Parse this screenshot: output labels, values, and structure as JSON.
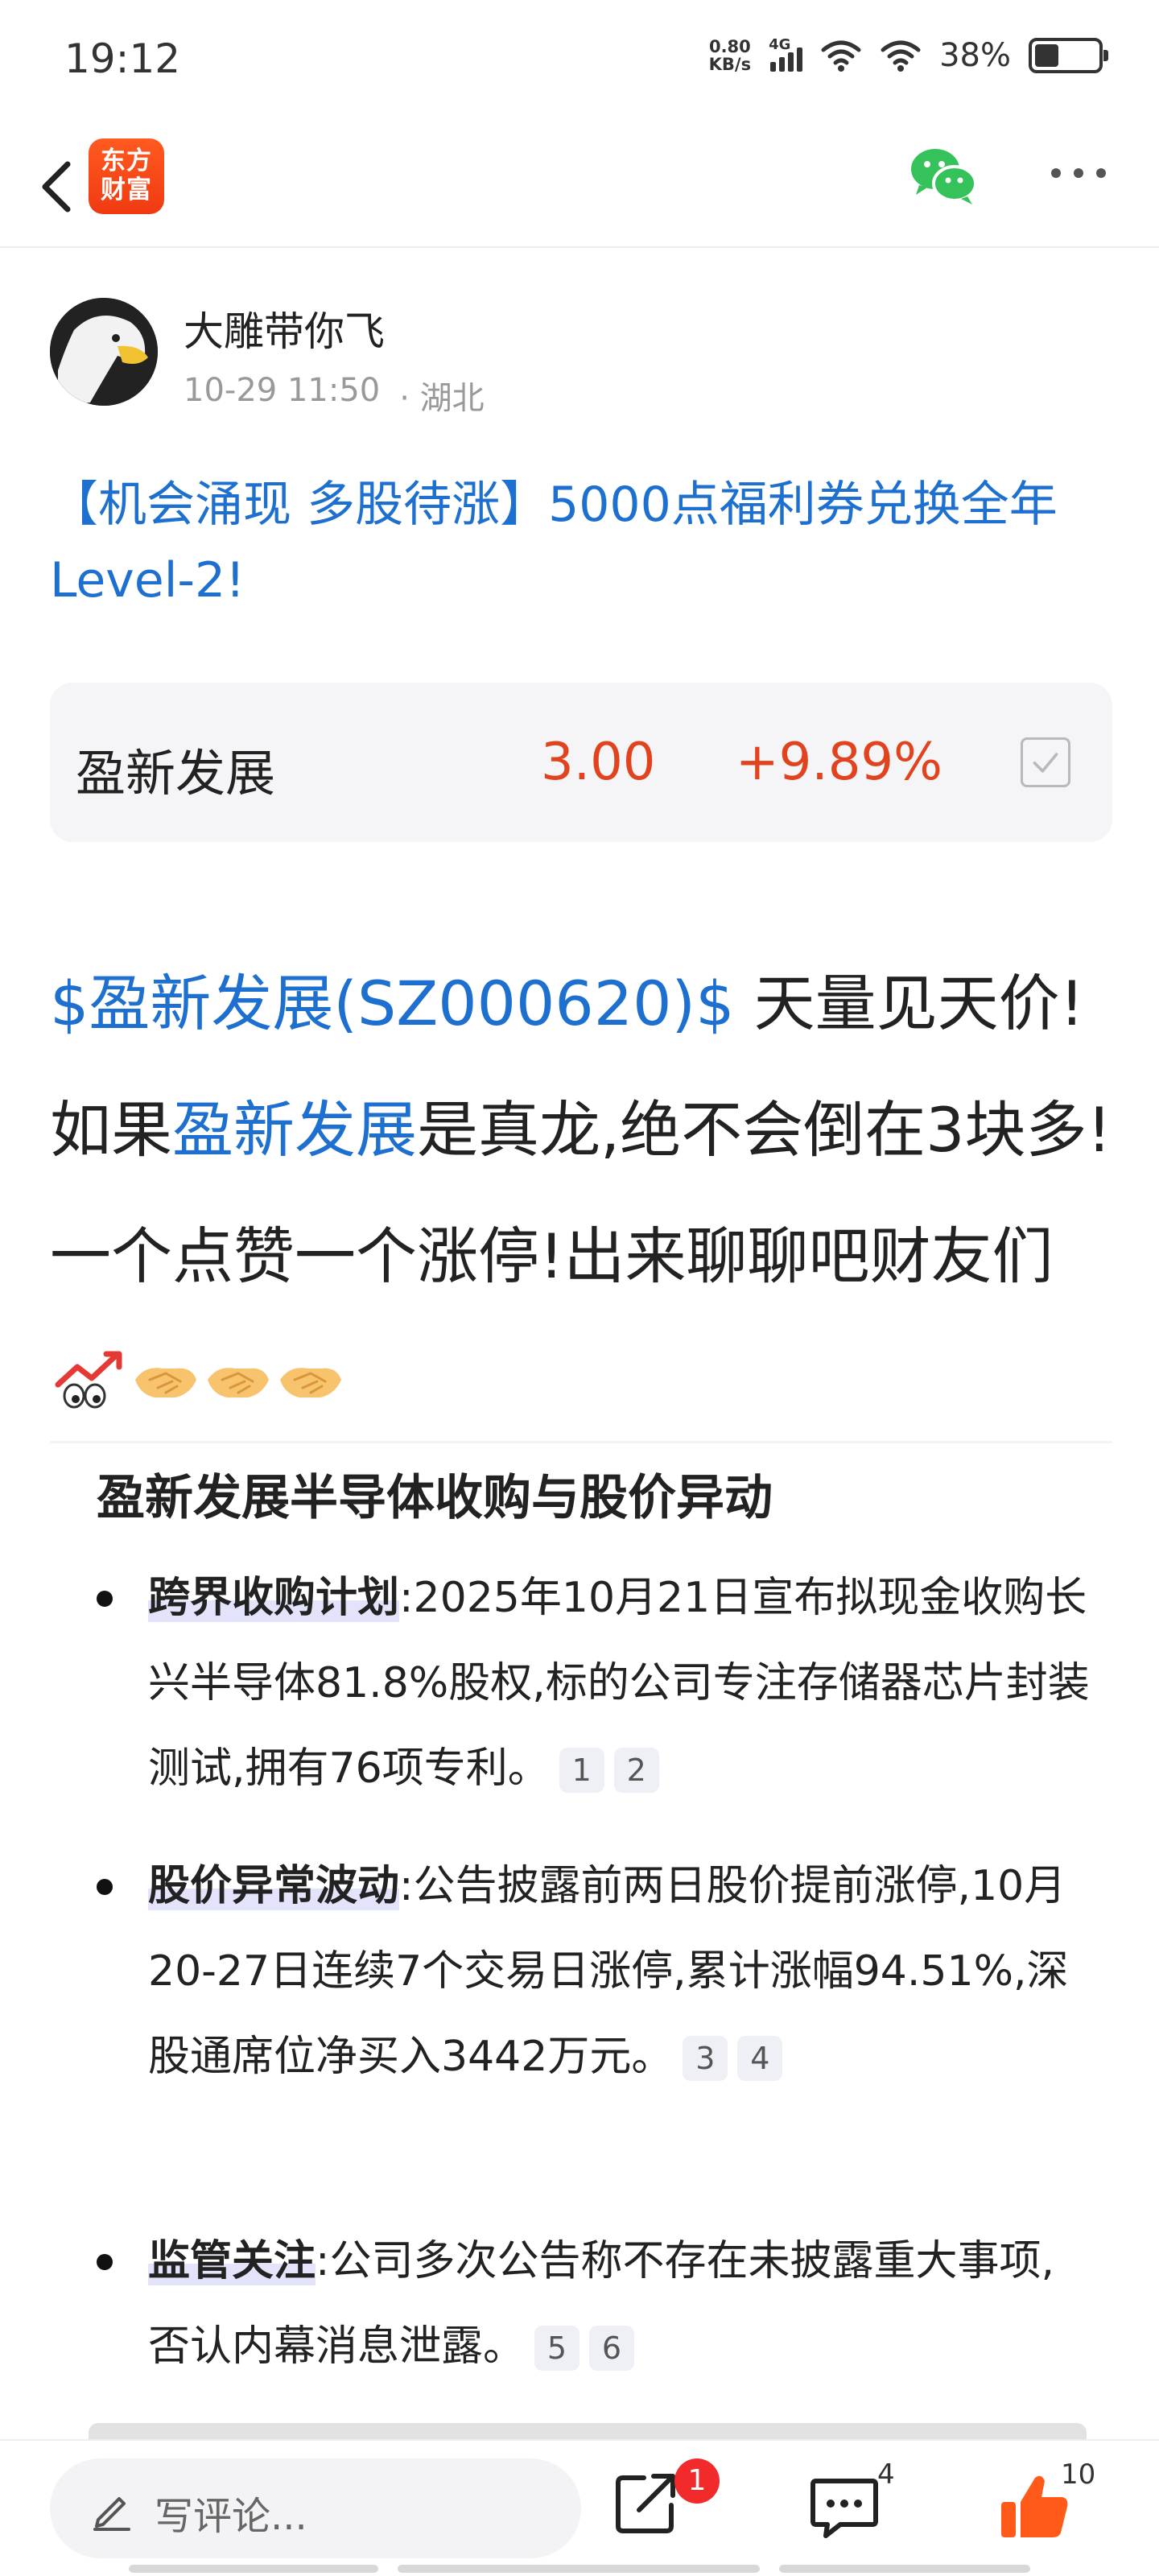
{
  "status_bar": {
    "time": "19:12",
    "net_speed_value": "0.80",
    "net_speed_unit": "KB/s",
    "network_type": "4G",
    "battery_percent": "38%",
    "battery_level": 0.38
  },
  "nav": {
    "logo_line1": "东方",
    "logo_line2": "财富"
  },
  "author": {
    "name": "大雕带你飞",
    "datetime": "10-29 11:50",
    "location": "· 湖北"
  },
  "post": {
    "title": "【机会涌现 多股待涨】5000点福利券兑换全年Level-2!",
    "stock_card": {
      "name": "盈新发展",
      "price": "3.00",
      "change": "+9.89%"
    },
    "body": {
      "stock_tag": "$盈新发展(SZ000620)$",
      "part1": "  天量见天价!如果",
      "stock_link": "盈新发展",
      "part2": "是真龙,绝不会倒在3块多!一个点赞一个涨停!出来聊聊吧财友们"
    }
  },
  "ai_summary": {
    "title": "盈新发展半导体收购与股价异动",
    "items": [
      {
        "heading": "跨界收购计划",
        "text": ":2025年10月21日宣布拟现金收购长兴半导体81.8%股权,标的公司专注存储器芯片封装测试,拥有76项专利。",
        "refs": [
          "1",
          "2"
        ]
      },
      {
        "heading": "股价异常波动",
        "text": ":公告披露前两日股价提前涨停,10月20-27日连续7个交易日涨停,累计涨幅94.51%,深股通席位净买入3442万元。",
        "refs": [
          "3",
          "4"
        ]
      },
      {
        "heading": "监管关注",
        "text": ":公司多次公告称不存在未披露重大事项,否认内幕消息泄露。",
        "refs": [
          "5",
          "6"
        ]
      }
    ]
  },
  "bottom_bar": {
    "comment_placeholder": "写评论...",
    "share_badge": "1",
    "comment_count": "4",
    "like_count": "10"
  },
  "colors": {
    "link_blue": "#1d6fd0",
    "stock_red": "#e2431f",
    "brand_orange": "#f03a12",
    "like_orange": "#ff5a1a",
    "wechat_green": "#35c25a"
  }
}
